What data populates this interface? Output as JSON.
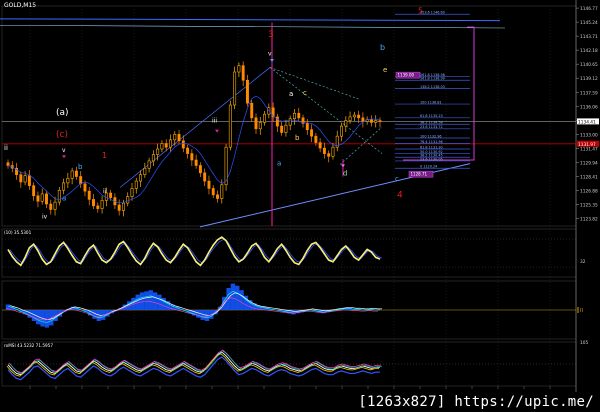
{
  "symbol": "GOLD,M15",
  "watermark": "[1263x827] https://upic.me/",
  "chart_data": {
    "type": "candlestick",
    "symbol": "GOLD,M15",
    "price_ylim": [
      1123.0,
      1147.0
    ],
    "price_axis_ticks": [
      "1146.77",
      "1145.24",
      "1143.71",
      "1142.18",
      "1140.65",
      "1139.12",
      "1137.59",
      "1136.06",
      "1134.53",
      "1133.00",
      "1131.47",
      "1129.94",
      "1128.41",
      "1126.88",
      "1125.35",
      "1123.82"
    ],
    "current_price_label": "1134.41",
    "red_line_price_label": "1131.97",
    "wave_labels": {
      "major": [
        "3",
        "4",
        "5"
      ],
      "degree": [
        "(a)",
        "(c)"
      ],
      "minor_roman": [
        "ii",
        "iii",
        "iv",
        "v"
      ],
      "minor_letters": [
        "a",
        "b",
        "c",
        "d",
        "e"
      ]
    },
    "fib_levels": [
      {
        "text": "423.6 1146.69",
        "price": 1146.1
      },
      {
        "text": "261.8 1138.98",
        "price": 1139.3
      },
      {
        "text": "161.8 1138.99",
        "price": 1138.9
      },
      {
        "text": "138.2 1138.03",
        "price": 1138.0
      },
      {
        "text": "100 1136.81",
        "price": 1136.3
      },
      {
        "text": "61.8 1135.23",
        "price": 1134.8
      },
      {
        "text": "38.2 1134.58",
        "price": 1134.1
      },
      {
        "text": "23.6 1133.72",
        "price": 1133.6
      },
      {
        "text": "100 1132.96",
        "price": 1132.6
      },
      {
        "text": "76.4 1131.96",
        "price": 1132.0
      },
      {
        "text": "61.8 1131.30",
        "price": 1131.4
      },
      {
        "text": "50.0 1130.92",
        "price": 1130.9
      },
      {
        "text": "38.2 1130.45",
        "price": 1130.5
      },
      {
        "text": "23.6 1130.05",
        "price": 1130.1
      },
      {
        "text": "0 1129.24",
        "price": 1129.3
      }
    ],
    "tag_labels": [
      "1139.00",
      "1128.71"
    ],
    "close_series": [
      1129.6,
      1129.3,
      1128.6,
      1127.8,
      1128.5,
      1127.4,
      1126.3,
      1125.7,
      1126.5,
      1125.4,
      1124.8,
      1125.6,
      1126.9,
      1127.7,
      1128.2,
      1129.0,
      1128.4,
      1127.6,
      1126.8,
      1125.9,
      1125.2,
      1124.9,
      1125.8,
      1126.6,
      1126.1,
      1125.3,
      1124.7,
      1125.5,
      1126.2,
      1127.1,
      1127.9,
      1128.6,
      1129.3,
      1130.1,
      1130.8,
      1131.4,
      1132.0,
      1131.6,
      1132.4,
      1133.0,
      1132.3,
      1131.5,
      1130.9,
      1130.2,
      1129.6,
      1128.8,
      1127.9,
      1127.1,
      1126.4,
      1126.0,
      1127.5,
      1131.6,
      1136.2,
      1139.8,
      1140.5,
      1138.9,
      1136.4,
      1134.8,
      1133.6,
      1134.3,
      1135.2,
      1135.9,
      1134.9,
      1133.9,
      1133.2,
      1134.0,
      1134.7,
      1135.3,
      1134.8,
      1134.2,
      1133.5,
      1132.8,
      1132.1,
      1131.5,
      1130.9,
      1130.6,
      1131.6,
      1132.8,
      1133.9,
      1134.5,
      1134.9,
      1135.1,
      1134.8,
      1134.4,
      1134.6,
      1134.3,
      1134.5,
      1134.4
    ],
    "oscillator_1": {
      "label": "(10) 35.5301",
      "right_label": "32",
      "values": [
        58,
        42,
        30,
        22,
        40,
        62,
        70,
        55,
        36,
        24,
        30,
        48,
        66,
        74,
        60,
        44,
        30,
        26,
        44,
        60,
        68,
        50,
        34,
        28,
        36,
        52,
        70,
        76,
        62,
        46,
        32,
        24,
        38,
        58,
        72,
        64,
        48,
        34,
        28,
        40,
        56,
        70,
        62,
        46,
        30,
        22,
        34,
        52,
        68,
        80,
        86,
        78,
        60,
        42,
        30,
        36,
        50,
        66,
        72,
        58,
        40,
        30,
        44,
        60,
        70,
        56,
        40,
        28,
        24,
        38,
        56,
        70,
        74,
        62,
        48,
        34,
        30,
        44,
        58,
        66,
        54,
        40,
        34,
        46,
        58,
        52,
        40,
        36
      ]
    },
    "oscillator_2": {
      "label": "",
      "right_label": "II",
      "values": [
        0.5,
        0.3,
        0.1,
        -0.2,
        -0.4,
        -0.7,
        -1.0,
        -1.3,
        -1.5,
        -1.6,
        -1.4,
        -1.0,
        -0.6,
        -0.2,
        0.1,
        0.3,
        0.2,
        0.0,
        -0.2,
        -0.5,
        -0.8,
        -1.0,
        -0.9,
        -0.6,
        -0.3,
        -0.1,
        0.2,
        0.5,
        0.8,
        1.1,
        1.4,
        1.6,
        1.7,
        1.8,
        1.6,
        1.4,
        1.1,
        0.8,
        0.5,
        0.3,
        0.1,
        -0.1,
        -0.3,
        -0.5,
        -0.7,
        -0.9,
        -1.0,
        -0.8,
        -0.4,
        0.3,
        1.2,
        2.0,
        2.4,
        2.2,
        1.8,
        1.3,
        0.9,
        0.6,
        0.4,
        0.3,
        0.2,
        0.1,
        0.0,
        -0.1,
        -0.2,
        -0.3,
        -0.4,
        -0.3,
        -0.2,
        -0.1,
        0.0,
        -0.1,
        -0.2,
        -0.3,
        -0.2,
        -0.1,
        0.0,
        0.1,
        0.2,
        0.2,
        0.1,
        0.1,
        0.0,
        0.0,
        0.1,
        0.0,
        0.0
      ]
    },
    "oscillator_3": {
      "label": "roMSI 43.5232 71.5957",
      "right_label": "105",
      "values": [
        52,
        48,
        45,
        44,
        47,
        50,
        54,
        55,
        52,
        49,
        46,
        45,
        48,
        51,
        53,
        50,
        47,
        46,
        49,
        52,
        55,
        53,
        50,
        48,
        47,
        49,
        52,
        54,
        52,
        50,
        48,
        47,
        49,
        51,
        53,
        52,
        50,
        48,
        47,
        49,
        51,
        53,
        51,
        49,
        47,
        46,
        48,
        52,
        56,
        60,
        62,
        59,
        55,
        51,
        48,
        49,
        51,
        53,
        52,
        50,
        48,
        47,
        49,
        51,
        52,
        51,
        49,
        48,
        47,
        48,
        50,
        52,
        53,
        51,
        49,
        48,
        48,
        50,
        51,
        50,
        49,
        49,
        50,
        51,
        50,
        49,
        50,
        50
      ]
    }
  }
}
